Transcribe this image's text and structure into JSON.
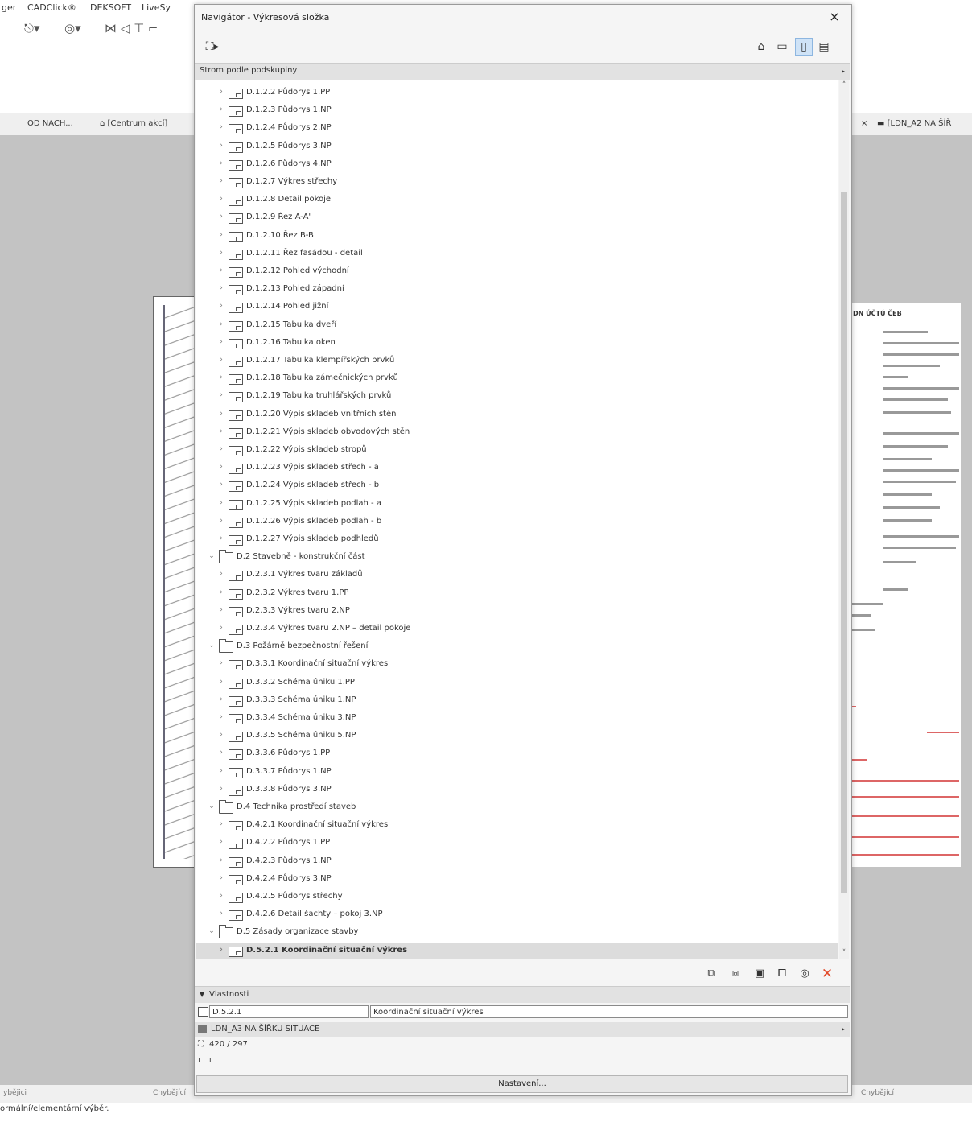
{
  "background_app": {
    "menu": [
      "ger",
      "CADClick®",
      "DEKSOFT",
      "LiveSy"
    ],
    "tabs": [
      "OD NACH...",
      "[Centrum akcí]",
      "[LDN_A2 NA ŠÍŘ"
    ],
    "tab_close": "×",
    "sheet_title": "DN ÚČTÚ ČEB",
    "bottom_labels": [
      "ybějici",
      "Chybějící",
      "Chybějící"
    ],
    "status": "ormální/elementární výběr."
  },
  "dialog": {
    "title": "Navigátor - Výkresová složka",
    "close": "×",
    "subgroup_label": "Strom podle podskupiny",
    "tree": [
      {
        "indent": 2,
        "kind": "file",
        "label": "D.1.2.2  Půdorys 1.PP"
      },
      {
        "indent": 2,
        "kind": "file",
        "label": "D.1.2.3  Půdorys 1.NP"
      },
      {
        "indent": 2,
        "kind": "file",
        "label": "D.1.2.4  Půdorys 2.NP"
      },
      {
        "indent": 2,
        "kind": "file",
        "label": "D.1.2.5  Půdorys 3.NP"
      },
      {
        "indent": 2,
        "kind": "file",
        "label": "D.1.2.6  Půdorys 4.NP"
      },
      {
        "indent": 2,
        "kind": "file",
        "label": "D.1.2.7  Výkres střechy"
      },
      {
        "indent": 2,
        "kind": "file",
        "label": "D.1.2.8 Detail pokoje"
      },
      {
        "indent": 2,
        "kind": "file",
        "label": "D.1.2.9  Řez A-A'"
      },
      {
        "indent": 2,
        "kind": "file",
        "label": "D.1.2.10 Řez B-B"
      },
      {
        "indent": 2,
        "kind": "file",
        "label": "D.1.2.11 Řez fasádou - detail"
      },
      {
        "indent": 2,
        "kind": "file",
        "label": "D.1.2.12  Pohled východní"
      },
      {
        "indent": 2,
        "kind": "file",
        "label": "D.1.2.13  Pohled západní"
      },
      {
        "indent": 2,
        "kind": "file",
        "label": "D.1.2.14     Pohled jižní"
      },
      {
        "indent": 2,
        "kind": "file",
        "label": "D.1.2.15  Tabulka dveří"
      },
      {
        "indent": 2,
        "kind": "file",
        "label": "D.1.2.16  Tabulka oken"
      },
      {
        "indent": 2,
        "kind": "file",
        "label": "D.1.2.17 Tabulka klempířských prvků"
      },
      {
        "indent": 2,
        "kind": "file",
        "label": "D.1.2.18 Tabulka zámečnických prvků"
      },
      {
        "indent": 2,
        "kind": "file",
        "label": "D.1.2.19  Tabulka truhlářských prvků"
      },
      {
        "indent": 2,
        "kind": "file",
        "label": "D.1.2.20  Výpis skladeb vnitřních stěn"
      },
      {
        "indent": 2,
        "kind": "file",
        "label": "D.1.2.21  Výpis skladeb obvodových stěn"
      },
      {
        "indent": 2,
        "kind": "file",
        "label": "D.1.2.22  Výpis skladeb stropů"
      },
      {
        "indent": 2,
        "kind": "file",
        "label": "D.1.2.23 Výpis skladeb střech - a"
      },
      {
        "indent": 2,
        "kind": "file",
        "label": "D.1.2.24  Výpis skladeb střech - b"
      },
      {
        "indent": 2,
        "kind": "file",
        "label": "D.1.2.25  Výpis skladeb podlah - a"
      },
      {
        "indent": 2,
        "kind": "file",
        "label": "D.1.2.26  Výpis skladeb podlah - b"
      },
      {
        "indent": 2,
        "kind": "file",
        "label": "D.1.2.27  Výpis skladeb podhledů"
      },
      {
        "indent": 1,
        "kind": "folder",
        "label": "D.2 Stavebně - konstrukční část"
      },
      {
        "indent": 2,
        "kind": "file",
        "label": "D.2.3.1  Výkres tvaru základů"
      },
      {
        "indent": 2,
        "kind": "file",
        "label": "D.2.3.2  Výkres tvaru 1.PP"
      },
      {
        "indent": 2,
        "kind": "file",
        "label": "D.2.3.3  Výkres tvaru 2.NP"
      },
      {
        "indent": 2,
        "kind": "file",
        "label": "D.2.3.4 Výkres tvaru 2.NP – detail pokoje"
      },
      {
        "indent": 1,
        "kind": "folder",
        "label": "D.3 Požárně bezpečnostní řešení"
      },
      {
        "indent": 2,
        "kind": "file",
        "label": "D.3.3.1  Koordinační situační výkres"
      },
      {
        "indent": 2,
        "kind": "file",
        "label": "D.3.3.2  Schéma úniku 1.PP"
      },
      {
        "indent": 2,
        "kind": "file",
        "label": "D.3.3.3  Schéma úniku 1.NP"
      },
      {
        "indent": 2,
        "kind": "file",
        "label": "D.3.3.4  Schéma úniku 3.NP"
      },
      {
        "indent": 2,
        "kind": "file",
        "label": "D.3.3.5  Schéma úniku 5.NP"
      },
      {
        "indent": 2,
        "kind": "file",
        "label": "D.3.3.6  Půdorys 1.PP"
      },
      {
        "indent": 2,
        "kind": "file",
        "label": "D.3.3.7  Půdorys 1.NP"
      },
      {
        "indent": 2,
        "kind": "file",
        "label": "D.3.3.8  Půdorys 3.NP"
      },
      {
        "indent": 1,
        "kind": "folder",
        "label": "D.4 Technika prostředí staveb"
      },
      {
        "indent": 2,
        "kind": "file",
        "label": "D.4.2.1  Koordinační situační výkres"
      },
      {
        "indent": 2,
        "kind": "file",
        "label": "D.4.2.2  Půdorys 1.PP"
      },
      {
        "indent": 2,
        "kind": "file",
        "label": "D.4.2.3  Půdorys 1.NP"
      },
      {
        "indent": 2,
        "kind": "file",
        "label": "D.4.2.4  Půdorys 3.NP"
      },
      {
        "indent": 2,
        "kind": "file",
        "label": "D.4.2.5  Půdorys střechy"
      },
      {
        "indent": 2,
        "kind": "file",
        "label": "D.4.2.6  Detail šachty – pokoj 3.NP"
      },
      {
        "indent": 1,
        "kind": "folder",
        "label": "D.5 Zásady organizace stavby"
      },
      {
        "indent": 2,
        "kind": "file",
        "label": "D.5.2.1  Koordinační situační výkres",
        "selected": true
      }
    ],
    "properties": {
      "header": "Vlastnosti",
      "id_value": "D.5.2.1",
      "name_value": "Koordinační situační výkres",
      "sheet_name": "LDN_A3 NA ŠÍŘKU SITUACE",
      "size": "420 / 297"
    },
    "settings_label": "Nastavení..."
  }
}
